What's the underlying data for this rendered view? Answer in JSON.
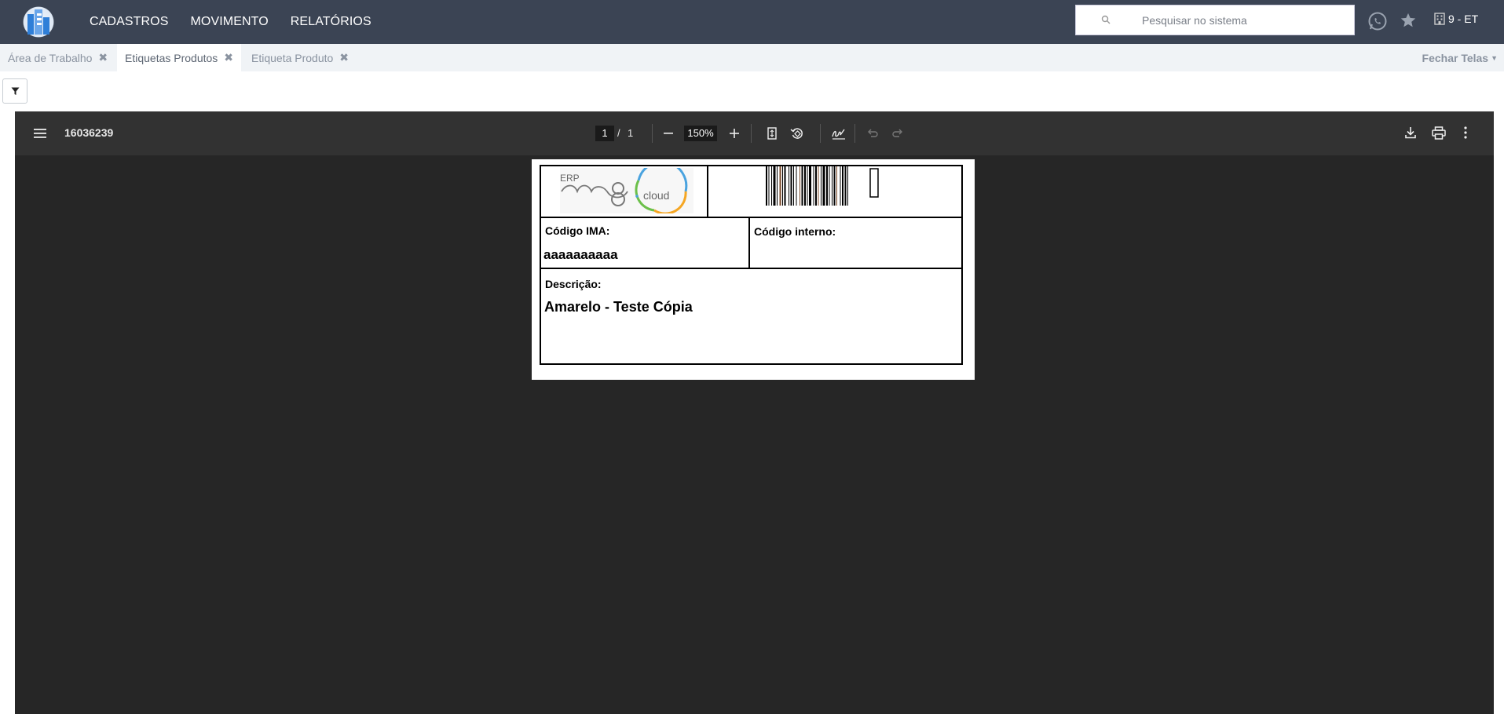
{
  "nav": {
    "menu": [
      "CADASTROS",
      "MOVIMENTO",
      "RELATÓRIOS"
    ],
    "search_placeholder": "Pesquisar no sistema",
    "company": "9 - ET"
  },
  "tabs": [
    {
      "label": "Área de Trabalho",
      "active": false
    },
    {
      "label": "Etiquetas Produtos",
      "active": true
    },
    {
      "label": "Etiqueta Produto",
      "active": false
    }
  ],
  "fechar_telas": "Fechar Telas",
  "viewer": {
    "doc_title": "16036239",
    "page_current": "1",
    "page_sep": "/",
    "page_total": "1",
    "zoom": "150%"
  },
  "label": {
    "logo_erp": "ERP",
    "logo_cloud": "cloud",
    "codigo_ima_label": "Código IMA:",
    "codigo_ima_value": "aaaaaaaaaa",
    "codigo_interno_label": "Código interno:",
    "descricao_label": "Descrição:",
    "descricao_value": "Amarelo - Teste  Cópia"
  }
}
